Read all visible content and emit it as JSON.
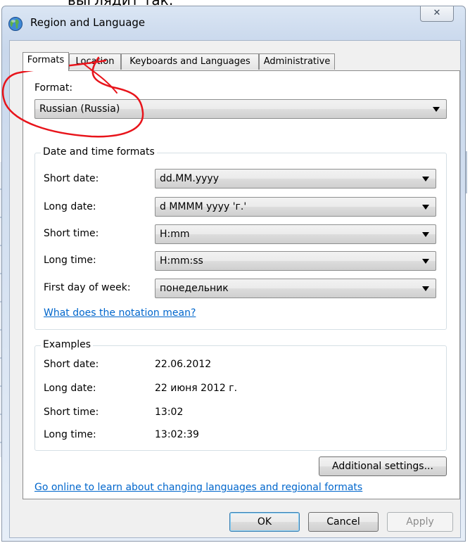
{
  "top_caption": "выглядит так:",
  "window": {
    "title": "Region and Language",
    "close_glyph": "✕"
  },
  "tabs": [
    {
      "label": "Formats",
      "active": true
    },
    {
      "label": "Location",
      "active": false
    },
    {
      "label": "Keyboards and Languages",
      "active": false
    },
    {
      "label": "Administrative",
      "active": false
    }
  ],
  "format": {
    "label": "Format:",
    "selected": "Russian (Russia)"
  },
  "date_time": {
    "legend": "Date and time formats",
    "rows": [
      {
        "label": "Short date:",
        "value": "dd.MM.yyyy"
      },
      {
        "label": "Long date:",
        "value": "d MMMM yyyy 'г.'"
      },
      {
        "label": "Short time:",
        "value": "H:mm"
      },
      {
        "label": "Long time:",
        "value": "H:mm:ss"
      },
      {
        "label": "First day of week:",
        "value": "понедельник"
      }
    ],
    "notation_link": "What does the notation mean?"
  },
  "examples": {
    "legend": "Examples",
    "rows": [
      {
        "label": "Short date:",
        "value": "22.06.2012"
      },
      {
        "label": "Long date:",
        "value": "22 июня 2012 г."
      },
      {
        "label": "Short time:",
        "value": "13:02"
      },
      {
        "label": "Long time:",
        "value": "13:02:39"
      }
    ]
  },
  "additional_settings_label": "Additional settings...",
  "online_link": "Go online to learn about changing languages and regional formats",
  "footer": {
    "ok_label": "OK",
    "cancel_label": "Cancel",
    "apply_label": "Apply"
  },
  "colors": {
    "link": "#0066cc",
    "annotation": "#e8141b"
  }
}
